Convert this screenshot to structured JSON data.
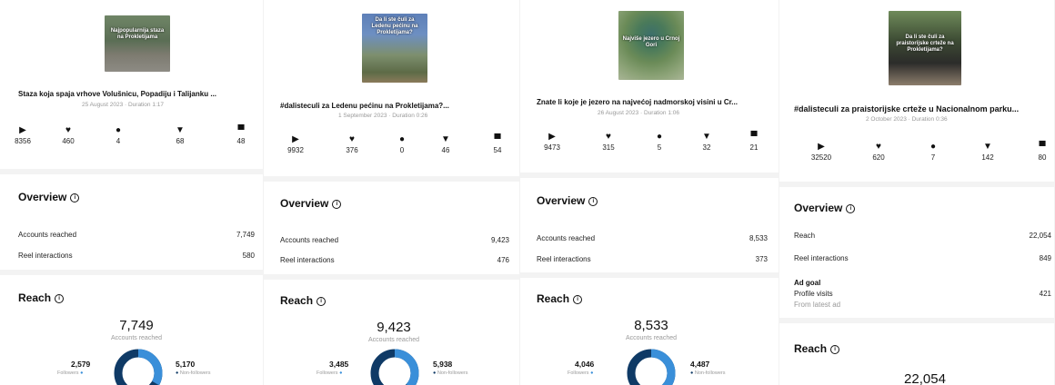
{
  "panels": [
    {
      "thumb_text": "Najpopularnija staza na Prokletijama",
      "title": "Staza koja spaja vrhove Volušnicu, Popadiju i  Talijanku ...",
      "date": "25 August 2023",
      "duration": "Duration 1:17",
      "stats": [
        "8356",
        "460",
        "4",
        "68",
        "48"
      ],
      "overview_title": "Overview",
      "rows": [
        {
          "label": "Accounts reached",
          "value": "7,749"
        },
        {
          "label": "Reel interactions",
          "value": "580"
        }
      ],
      "reach_title": "Reach",
      "reach_value": "7,749",
      "reach_label": "Accounts reached",
      "followers_value": "2,579",
      "followers_label": "Followers",
      "nonfollowers_value": "5,170",
      "nonfollowers_label": "Non-followers",
      "followers_fraction": 0.333
    },
    {
      "thumb_text": "Da li ste čuli za Ledenu pećinu na Prokletijama?",
      "title": "#dalisteculi za Ledenu pećinu na Prokletijama?...",
      "date": "1 September 2023",
      "duration": "Duration 0:26",
      "stats": [
        "9932",
        "376",
        "0",
        "46",
        "54"
      ],
      "overview_title": "Overview",
      "rows": [
        {
          "label": "Accounts reached",
          "value": "9,423"
        },
        {
          "label": "Reel interactions",
          "value": "476"
        }
      ],
      "reach_title": "Reach",
      "reach_value": "9,423",
      "reach_label": "Accounts reached",
      "followers_value": "3,485",
      "followers_label": "Followers",
      "nonfollowers_value": "5,938",
      "nonfollowers_label": "Non-followers",
      "followers_fraction": 0.37
    },
    {
      "thumb_text": "Najviše jezero u Crnoj Gori",
      "title": "Znate li koje je jezero na najvećoj nadmorskoj visini u Cr...",
      "date": "26 August 2023",
      "duration": "Duration 1:06",
      "stats": [
        "9473",
        "315",
        "5",
        "32",
        "21"
      ],
      "overview_title": "Overview",
      "rows": [
        {
          "label": "Accounts reached",
          "value": "8,533"
        },
        {
          "label": "Reel interactions",
          "value": "373"
        }
      ],
      "reach_title": "Reach",
      "reach_value": "8,533",
      "reach_label": "Accounts reached",
      "followers_value": "4,046",
      "followers_label": "Followers",
      "nonfollowers_value": "4,487",
      "nonfollowers_label": "Non-followers",
      "followers_fraction": 0.474
    },
    {
      "thumb_text": "Da li ste čuli za praistorijske crteže na Prokletijama?",
      "title": "#dalisteculi za praistorijske crteže u Nacionalnom parku...",
      "date": "2 October 2023",
      "duration": "Duration 0:36",
      "stats": [
        "32520",
        "620",
        "7",
        "142",
        "80"
      ],
      "overview_title": "Overview",
      "rows": [
        {
          "label": "Reach",
          "value": "22,054"
        },
        {
          "label": "Reel interactions",
          "value": "849"
        }
      ],
      "ad_goal_label": "Ad goal",
      "ad_goal_item": "Profile visits",
      "ad_goal_value": "421",
      "ad_goal_source": "From latest ad",
      "reach_title": "Reach",
      "reach_value": "22,054"
    }
  ],
  "stat_icons": [
    "play-icon",
    "heart-icon",
    "comment-icon",
    "share-icon",
    "bookmark-icon"
  ],
  "colors": {
    "followers": "#3a8fd9",
    "nonfollowers": "#0f3a66",
    "divider": "#f3f3f3"
  }
}
